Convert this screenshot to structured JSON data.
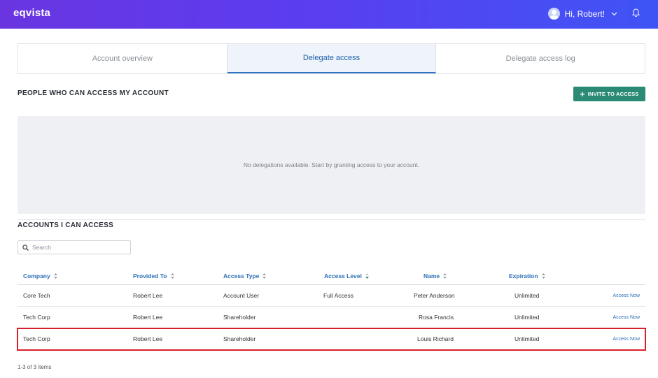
{
  "header": {
    "logo": "eqvista",
    "greeting": "Hi, Robert!"
  },
  "tabs": [
    {
      "label": "Account overview",
      "active": false
    },
    {
      "label": "Delegate access",
      "active": true
    },
    {
      "label": "Delegate access log",
      "active": false
    }
  ],
  "people_section": {
    "title": "PEOPLE WHO CAN ACCESS MY ACCOUNT",
    "invite_label": "INVITE TO ACCESS",
    "empty_message": "No delegations available. Start by granting access to your account."
  },
  "accounts_section": {
    "title": "ACCOUNTS I CAN ACCESS",
    "search_placeholder": "Search"
  },
  "table": {
    "columns": [
      "Company",
      "Provided To",
      "Access Type",
      "Access Level",
      "Name",
      "Expiration"
    ],
    "rows": [
      {
        "company": "Core Tech",
        "provided_to": "Robert Lee",
        "access_type": "Account User",
        "access_level": "Full Access",
        "name": "Peter Anderson",
        "expiration": "Unlimited",
        "action": "Access Now"
      },
      {
        "company": "Tech Corp",
        "provided_to": "Robert Lee",
        "access_type": "Shareholder",
        "access_level": "",
        "name": "Rosa Francis",
        "expiration": "Unlimited",
        "action": "Access Now"
      },
      {
        "company": "Tech Corp",
        "provided_to": "Robert Lee",
        "access_type": "Shareholder",
        "access_level": "",
        "name": "Louis Richard",
        "expiration": "Unlimited",
        "action": "Access Now"
      }
    ]
  },
  "pagination": {
    "summary": "1-3 of 3 items"
  },
  "colors": {
    "accent_blue": "#2b6fb6",
    "invite_green": "#2a8a74",
    "highlight_red": "#d8202b"
  }
}
